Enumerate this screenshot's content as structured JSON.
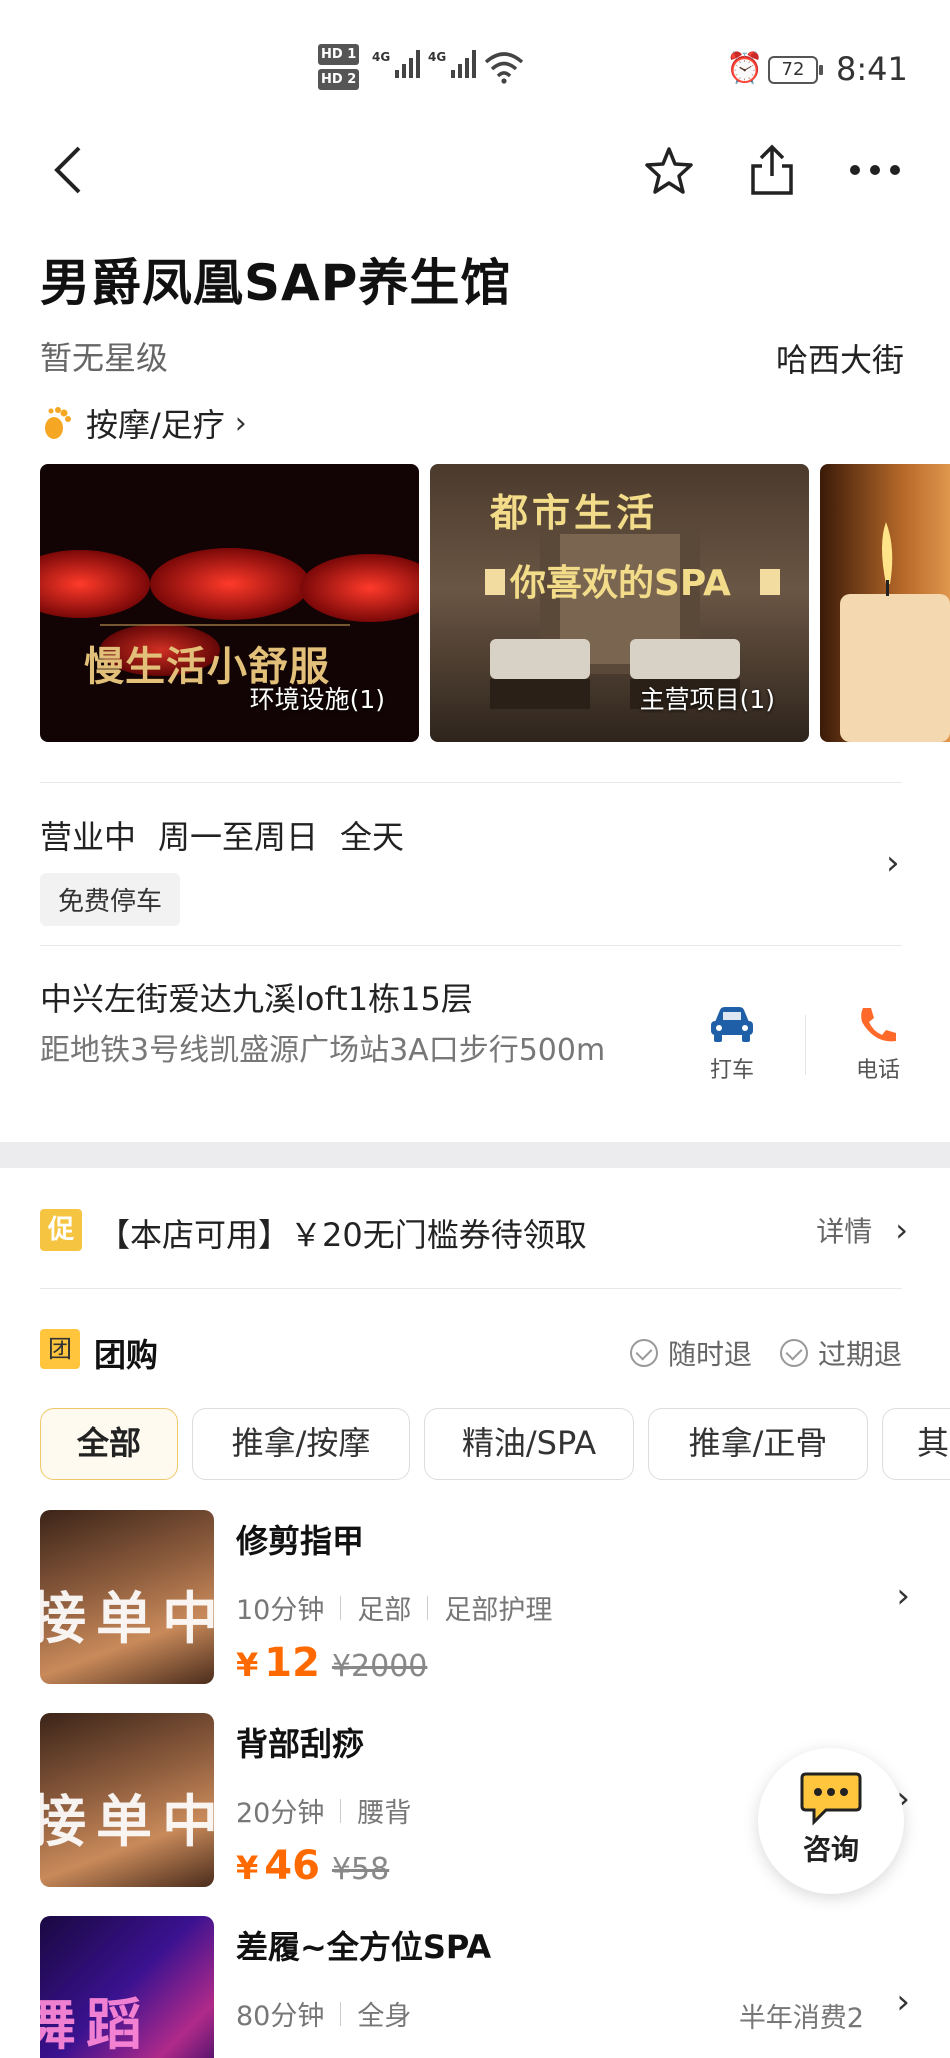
{
  "status_bar": {
    "hd1": "HD 1",
    "hd2": "HD 2",
    "net1": "4G",
    "net2": "4G",
    "battery": "72",
    "time": "8:41"
  },
  "nav": {
    "back_icon": "chevron-left-icon",
    "favorite_icon": "star-outline-icon",
    "share_icon": "share-icon",
    "more_icon": "more-dots-icon"
  },
  "shop": {
    "name": "男爵凤凰SAP养生馆",
    "star_level": "暂无星级",
    "district": "哈西大街",
    "category": "按摩/足疗"
  },
  "photos": [
    {
      "caption": "环境设施(1)",
      "overlay": "慢生活小舒服"
    },
    {
      "caption": "主营项目(1)",
      "overlay1": "都市生活",
      "overlay2": "你喜欢的SPA"
    },
    {
      "caption": ""
    }
  ],
  "hours": {
    "status": "营业中",
    "days": "周一至周日",
    "time": "全天",
    "tag": "免费停车"
  },
  "address": {
    "line": "中兴左街爱达九溪loft1栋15层",
    "subway": "距地铁3号线凯盛源广场站3A口步行500m",
    "taxi_label": "打车",
    "phone_label": "电话"
  },
  "promo": {
    "badge": "促",
    "text": "【本店可用】￥20无门槛券待领取",
    "more": "详情"
  },
  "group_buy": {
    "badge": "团",
    "title": "团购",
    "refund1": "随时退",
    "refund2": "过期退",
    "filters": [
      "全部",
      "推拿/按摩",
      "精油/SPA",
      "推拿/正骨",
      "其"
    ]
  },
  "deals": [
    {
      "name": "修剪指甲",
      "duration": "10分钟",
      "part": "足部",
      "type": "足部护理",
      "price": "12",
      "old_price": "2000",
      "sales": ""
    },
    {
      "name": "背部刮痧",
      "duration": "20分钟",
      "part": "腰背",
      "type": "",
      "price": "46",
      "old_price": "58",
      "sales": ""
    },
    {
      "name": "差履~全方位SPA",
      "duration": "80分钟",
      "part": "全身",
      "type": "",
      "price": "",
      "old_price": "",
      "sales": "半年消费2"
    }
  ],
  "consult": {
    "label": "咨询"
  },
  "colors": {
    "accent": "#ff6a00",
    "badge_yellow": "#ffc53d",
    "taxi_blue": "#1f5fa8",
    "phone_orange": "#ff6a2a"
  }
}
